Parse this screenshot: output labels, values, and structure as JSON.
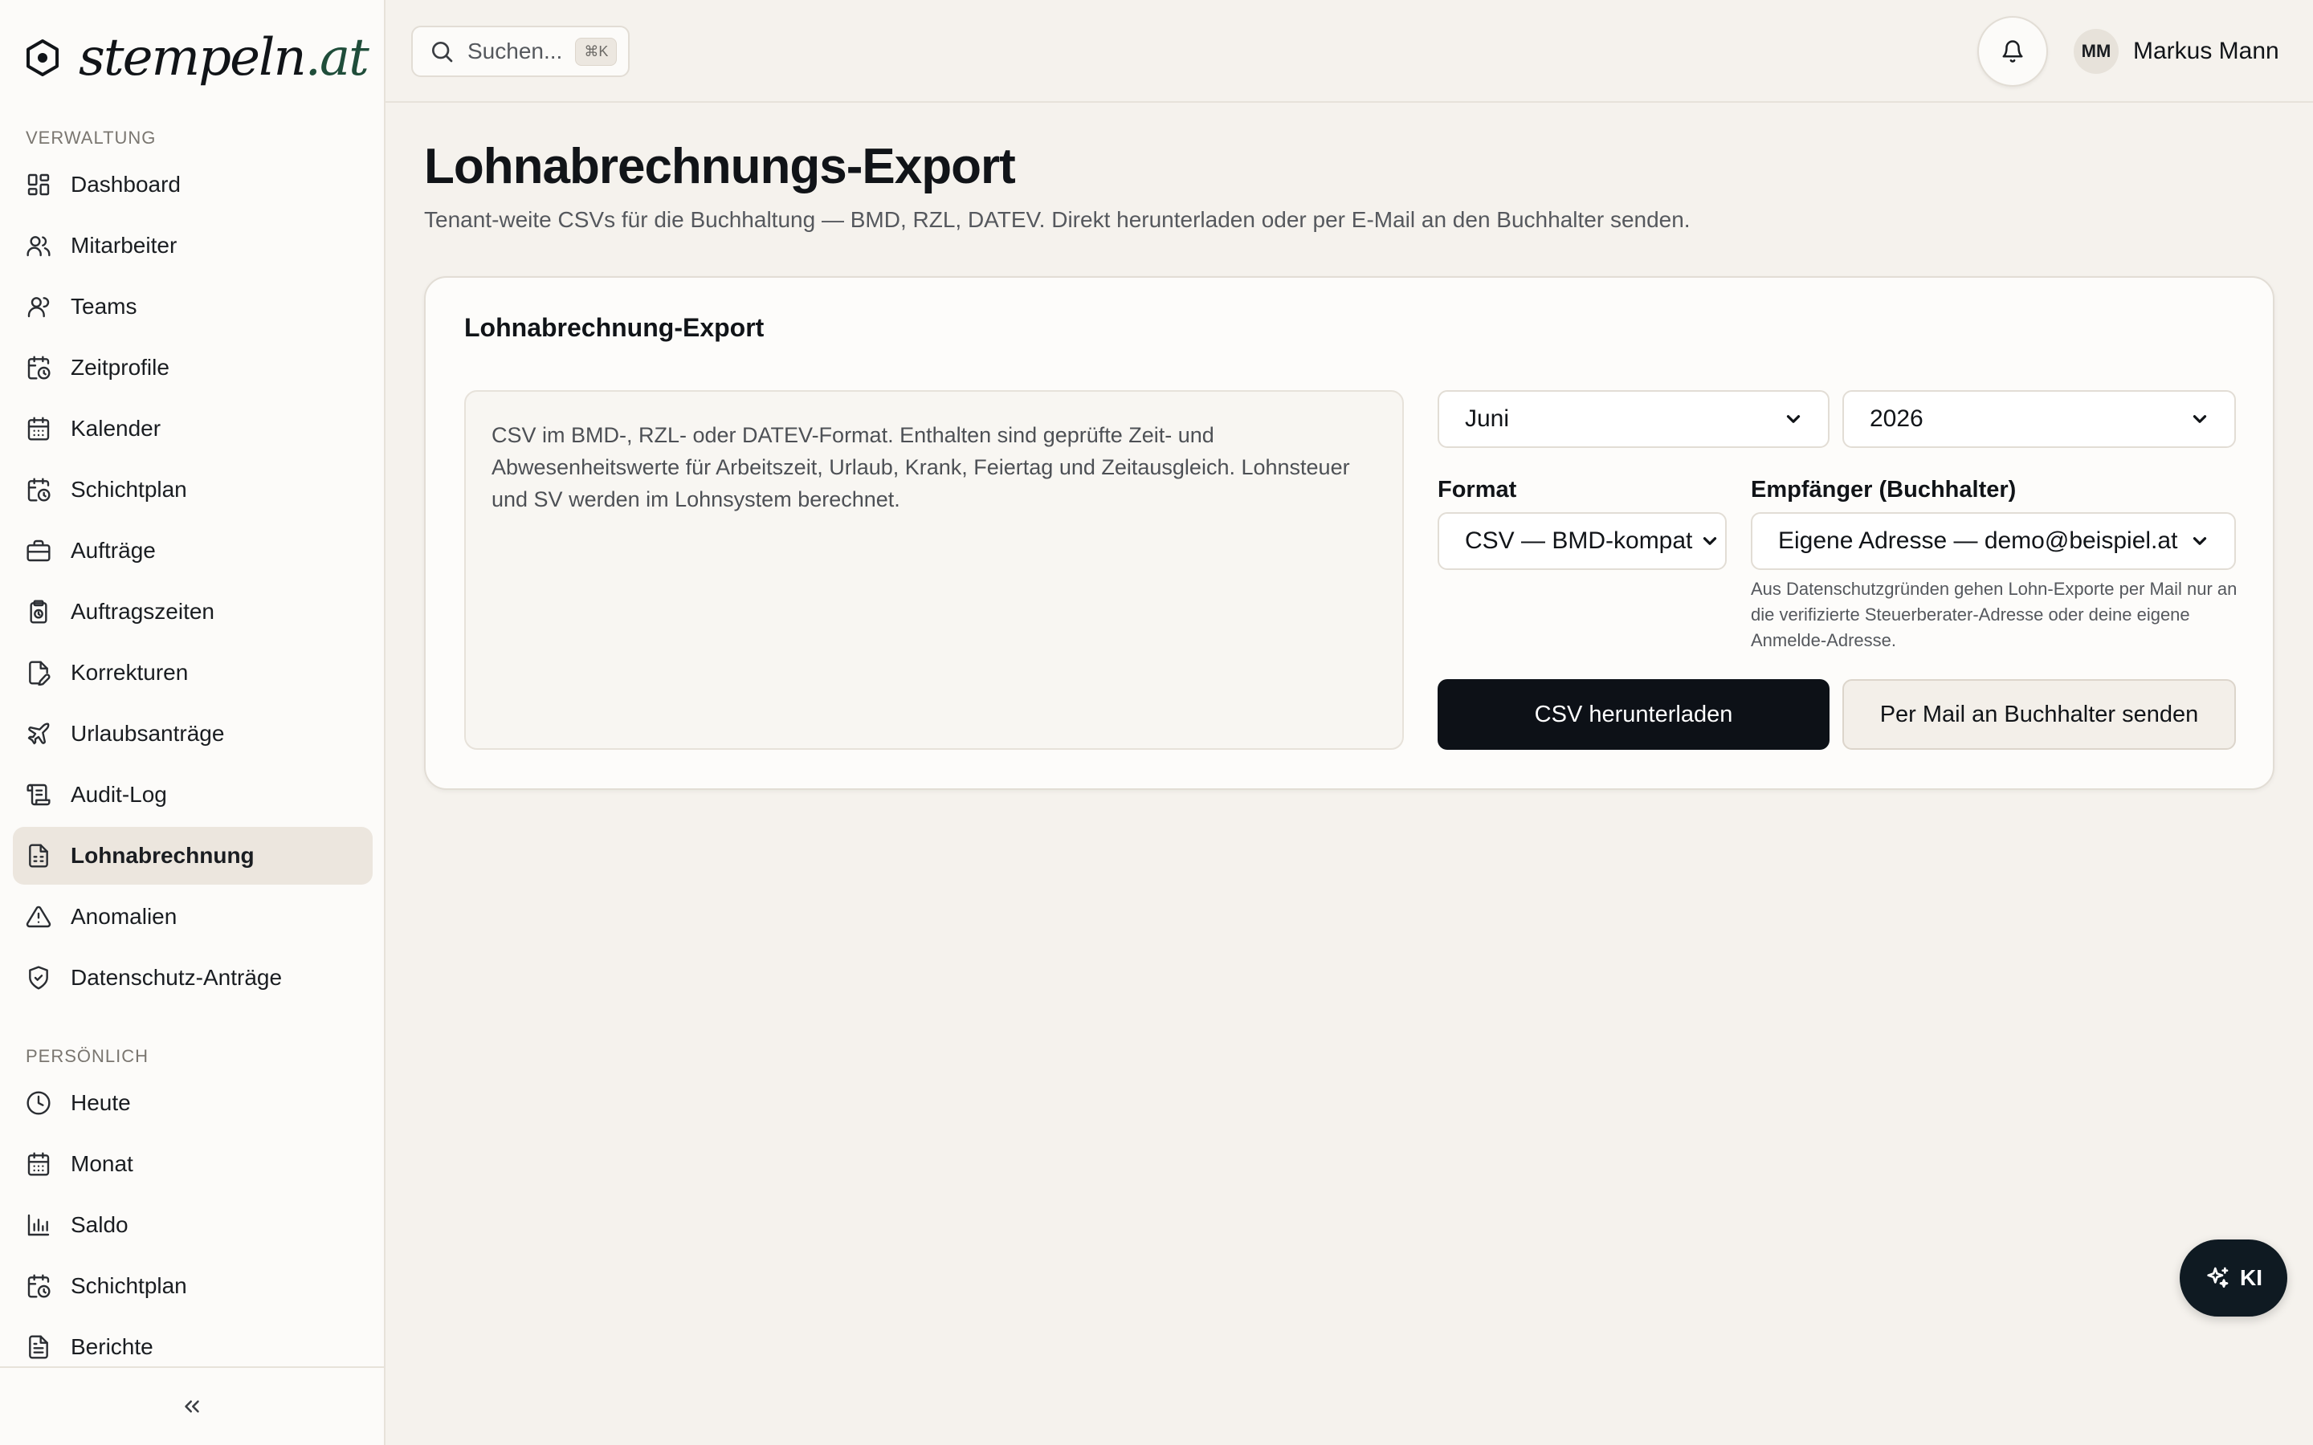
{
  "brand": {
    "name": "stempeln",
    "tld": ".at"
  },
  "sidebar": {
    "sections": [
      {
        "title": "VERWALTUNG",
        "items": [
          {
            "label": "Dashboard",
            "icon": "dashboard-icon"
          },
          {
            "label": "Mitarbeiter",
            "icon": "users-icon"
          },
          {
            "label": "Teams",
            "icon": "user-icon"
          },
          {
            "label": "Zeitprofile",
            "icon": "calendar-clock-icon"
          },
          {
            "label": "Kalender",
            "icon": "calendar-icon"
          },
          {
            "label": "Schichtplan",
            "icon": "calendar-clock-icon"
          },
          {
            "label": "Aufträge",
            "icon": "briefcase-icon"
          },
          {
            "label": "Auftragszeiten",
            "icon": "clipboard-clock-icon"
          },
          {
            "label": "Korrekturen",
            "icon": "file-pen-icon"
          },
          {
            "label": "Urlaubsanträge",
            "icon": "plane-icon"
          },
          {
            "label": "Audit-Log",
            "icon": "scroll-icon"
          },
          {
            "label": "Lohnabrechnung",
            "icon": "file-spreadsheet-icon",
            "active": true
          },
          {
            "label": "Anomalien",
            "icon": "warning-icon"
          },
          {
            "label": "Datenschutz-Anträge",
            "icon": "shield-check-icon"
          }
        ]
      },
      {
        "title": "PERSÖNLICH",
        "items": [
          {
            "label": "Heute",
            "icon": "clock-icon"
          },
          {
            "label": "Monat",
            "icon": "calendar-icon"
          },
          {
            "label": "Saldo",
            "icon": "bar-chart-icon"
          },
          {
            "label": "Schichtplan",
            "icon": "calendar-clock-icon"
          },
          {
            "label": "Berichte",
            "icon": "file-text-icon"
          }
        ]
      }
    ],
    "collapse_icon": "chevrons-left-icon"
  },
  "header": {
    "search": {
      "placeholder": "Suchen...",
      "shortcut": "⌘K"
    },
    "user": {
      "initials": "MM",
      "name": "Markus Mann"
    }
  },
  "main": {
    "title": "Lohnabrechnungs-Export",
    "subtitle": "Tenant-weite CSVs für die Buchhaltung — BMD, RZL, DATEV. Direkt herunterladen oder per E-Mail an den Buchhalter senden.",
    "card": {
      "title": "Lohnabrechnung-Export",
      "description": "CSV im BMD-, RZL- oder DATEV-Format. Enthalten sind geprüfte Zeit- und Abwesenheitswerte für Arbeitszeit, Urlaub, Krank, Feiertag und Zeitausgleich. Lohnsteuer und SV werden im Lohnsystem berechnet.",
      "month": "Juni",
      "year": "2026",
      "format_label": "Format",
      "format_value": "CSV — BMD-kompatibel",
      "recipient_label": "Empfänger (Buchhalter)",
      "recipient_value": "Eigene Adresse — demo@beispiel.at",
      "hint": "Aus Datenschutzgründen gehen Lohn-Exporte per Mail nur an die verifizierte Steuerberater-Adresse oder deine eigene Anmelde-Adresse.",
      "download_button": "CSV herunterladen",
      "mail_button": "Per Mail an Buchhalter senden"
    }
  },
  "fab": {
    "label": "KI",
    "icon": "sparkles-icon"
  },
  "colors": {
    "background": "#f5f2ed",
    "sidebar": "#fcfbf9",
    "primary": "#0d1117",
    "active_item": "#ece6de",
    "brand_accent": "#1f4d3a"
  }
}
